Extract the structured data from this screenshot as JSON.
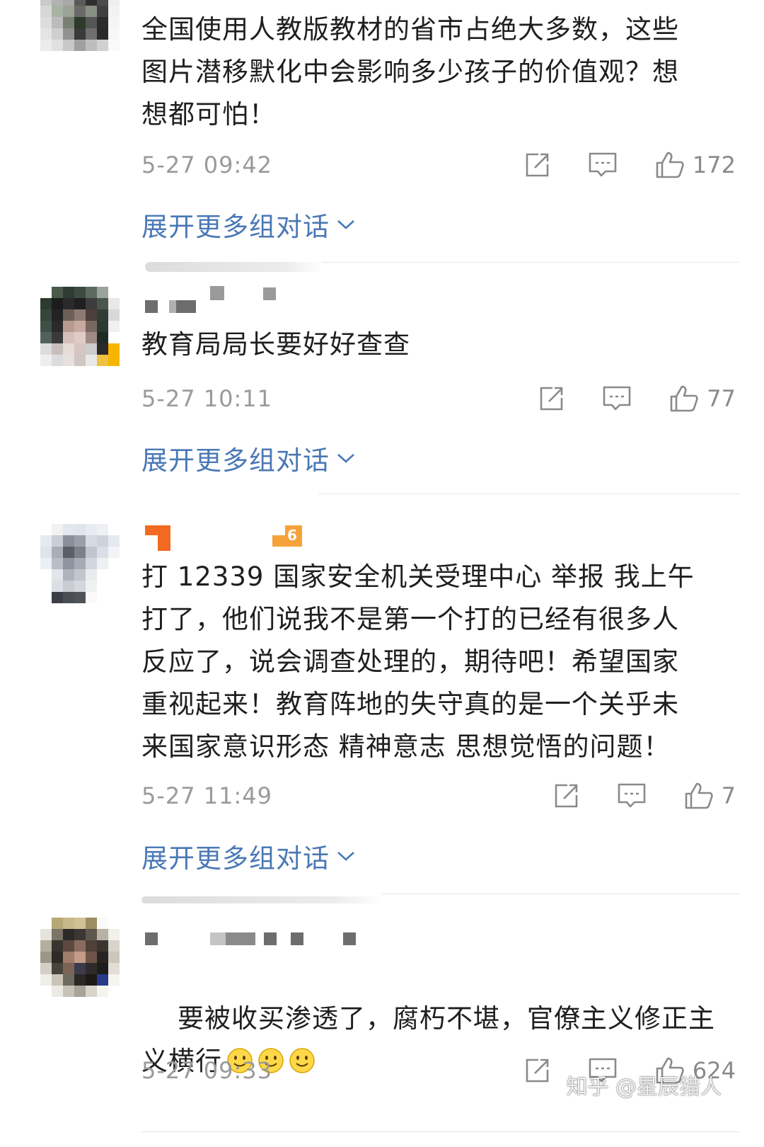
{
  "comments": [
    {
      "text": "全国使用人教版教材的省市占绝大多数，这些\n图片潜移默化中会影响多少孩子的价值观？想\n想都可怕！",
      "time": "5-27 09:42",
      "likes": "172",
      "expand_label": "展开更多组对话"
    },
    {
      "text": "教育局局长要好好查查",
      "time": "5-27 10:11",
      "likes": "77",
      "expand_label": "展开更多组对话"
    },
    {
      "text": "打 12339 国家安全机关受理中心 举报 我上午\n打了，他们说我不是第一个打的已经有很多人\n反应了，说会调查处理的，期待吧！希望国家\n重视起来！教育阵地的失守真的是一个关乎未\n来国家意识形态 精神意志 思想觉悟的问题！",
      "time": "5-27 11:49",
      "likes": "7",
      "badge": "6",
      "expand_label": "展开更多组对话"
    },
    {
      "text": "要被收买渗透了，腐朽不堪，官僚主义修正主\n义横行",
      "time": "5-27 09:33",
      "likes": "624"
    }
  ],
  "icons": {
    "share": "share-icon",
    "comment": "comment-icon",
    "like": "thumbs-up-icon",
    "expand": "chevron-down-icon",
    "emoji": "smile-emoji-icon"
  },
  "colors": {
    "link": "#4a78b5",
    "meta": "#9a9a9a",
    "text": "#1f1f1f",
    "divider": "#e6e6e6"
  },
  "watermark": "知乎 @星辰猎人"
}
